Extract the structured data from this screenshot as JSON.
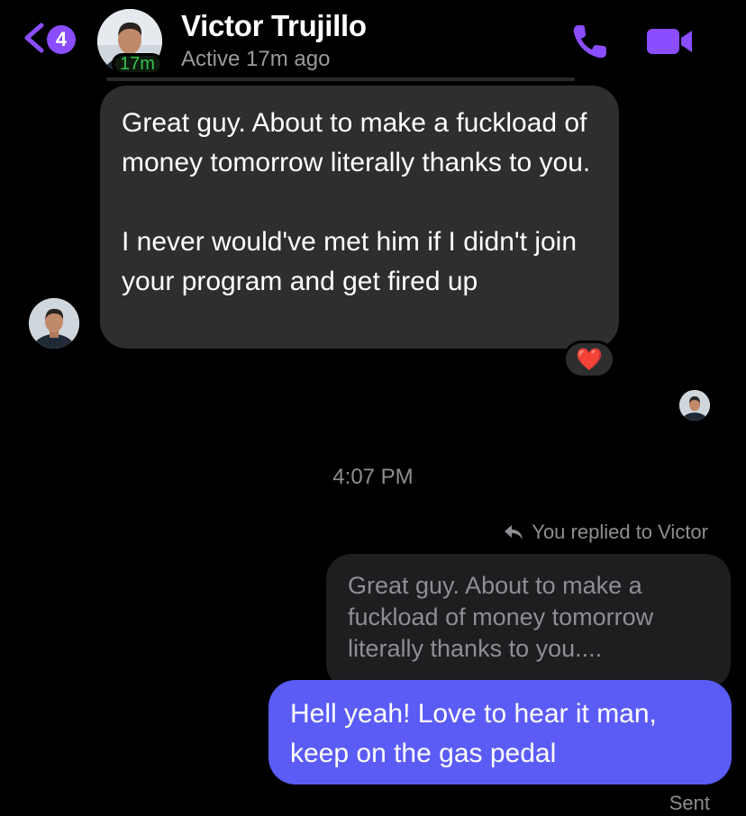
{
  "header": {
    "back_count": "4",
    "contact_name": "Victor Trujillo",
    "active_badge": "17m",
    "status": "Active 17m ago",
    "call_icon": "phone-icon",
    "video_icon": "video-camera-icon"
  },
  "thread": {
    "incoming": {
      "paragraph_1": "Great guy. About to make a fuckload of money tomorrow literally thanks to you.",
      "paragraph_2": "I never would've met him if I didn't join your program and get fired up",
      "reaction": "❤️"
    },
    "timestamp": "4:07 PM",
    "reply_context": "You replied to Victor",
    "quoted_text": "Great guy. About to make a fuckload of money tomorrow literally thanks to you....",
    "outgoing": {
      "text": "Hell yeah! Love to hear it man, keep on the gas pedal",
      "status": "Sent"
    }
  },
  "colors": {
    "accent": "#8a4dff",
    "outgoing_bubble": "#5b5cf6",
    "incoming_bubble": "#2e2e30",
    "active_green": "#35c24c"
  }
}
